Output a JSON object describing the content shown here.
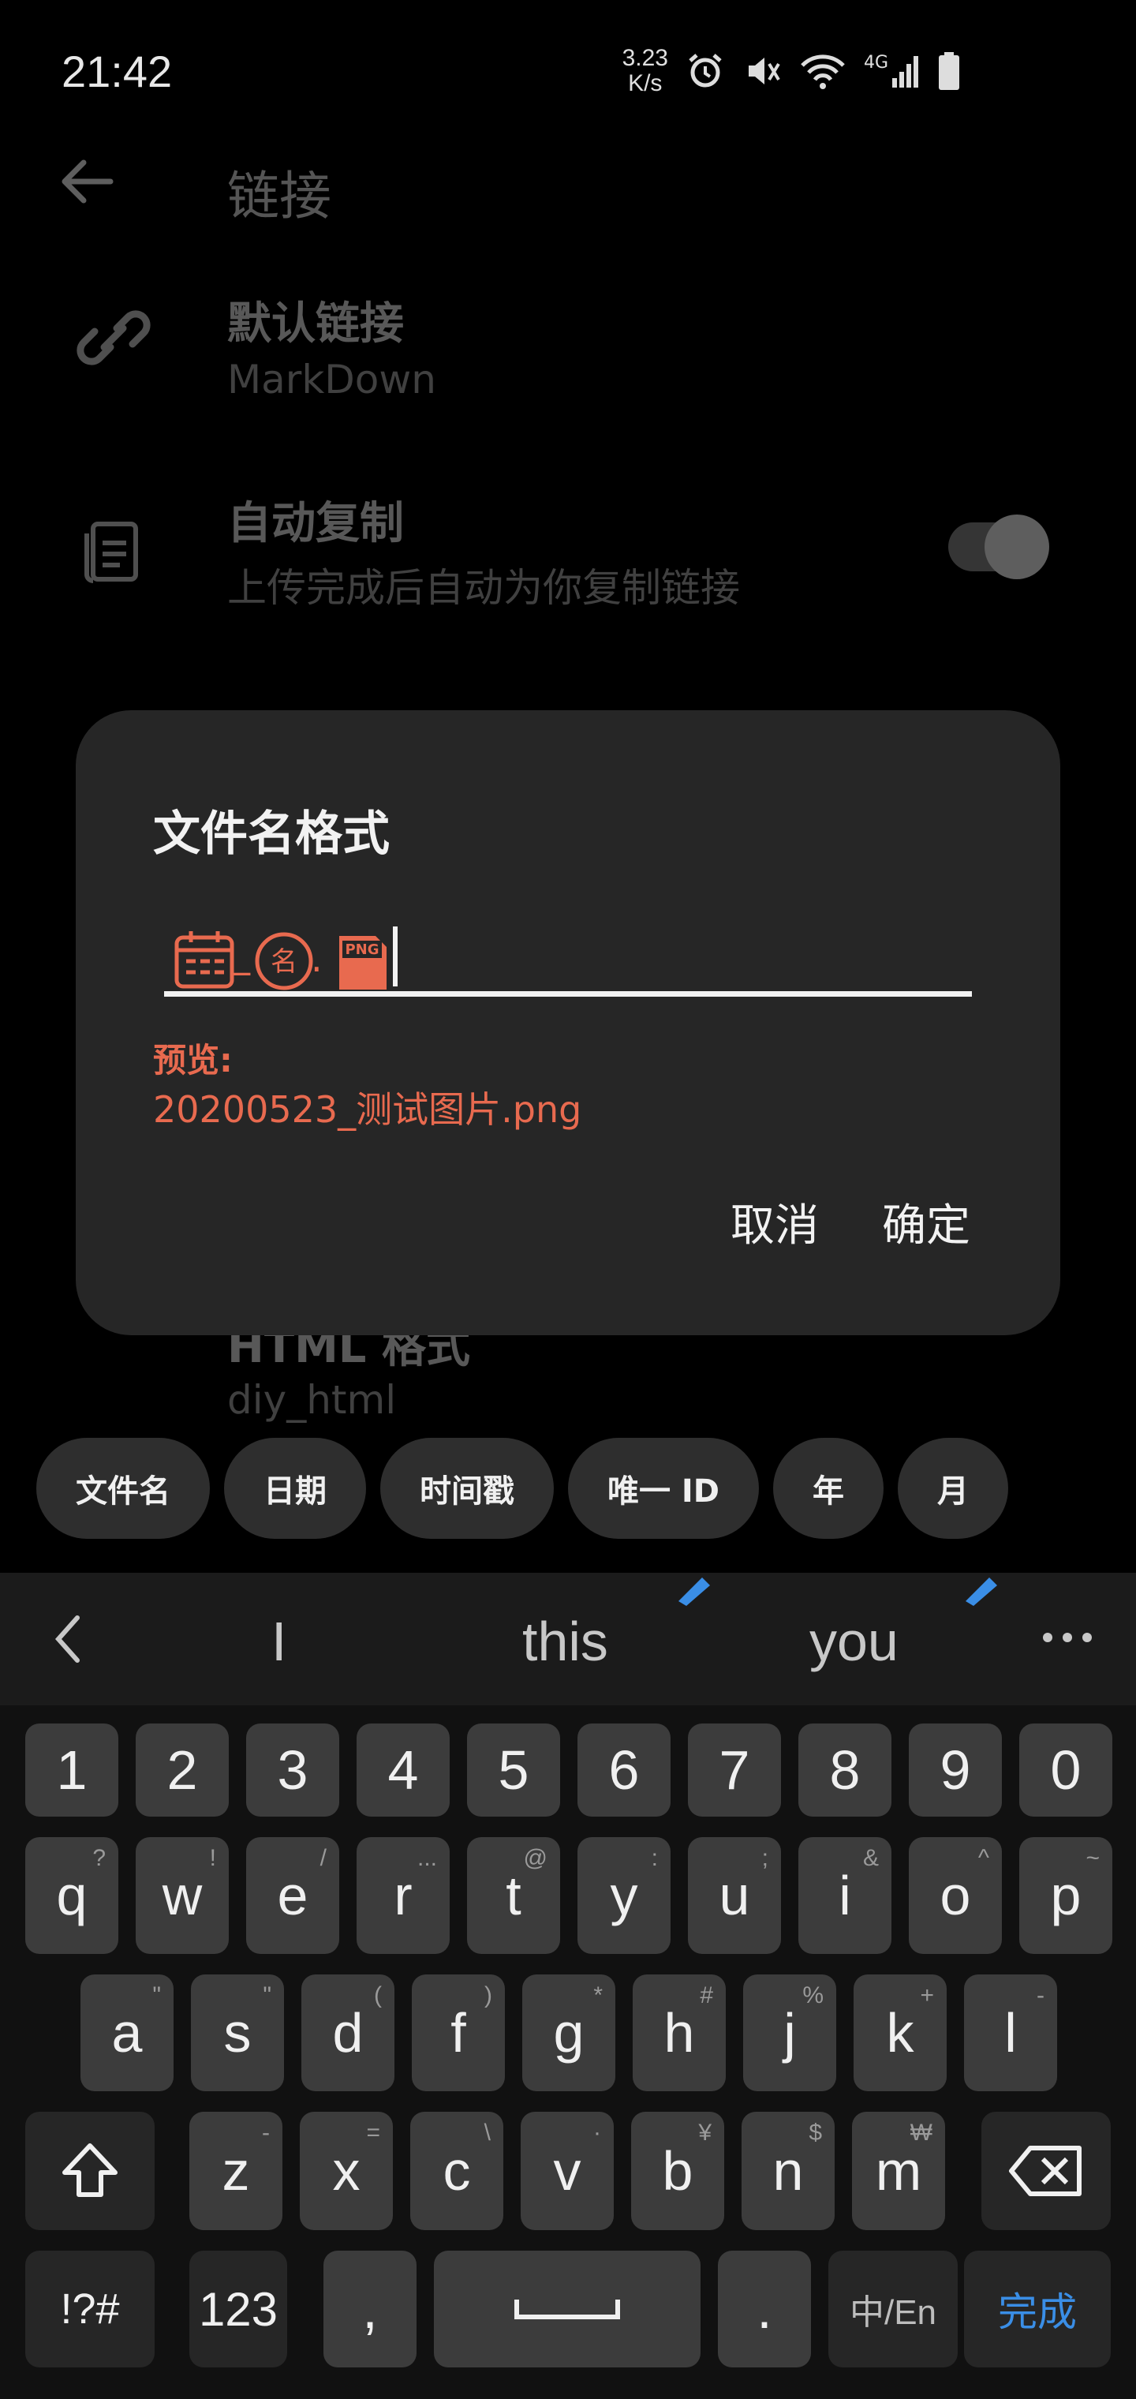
{
  "status": {
    "time": "21:42",
    "net_speed_top": "3.23",
    "net_speed_bottom": "K/s",
    "network": "4G"
  },
  "page": {
    "title": "链接",
    "items": [
      {
        "title": "默认链接",
        "subtitle": "MarkDown"
      },
      {
        "title": "自动复制",
        "subtitle": "上传完成后自动为你复制链接",
        "toggle_on": true
      },
      {
        "title": "HTML 格式",
        "subtitle": "diy_html"
      }
    ]
  },
  "dialog": {
    "title": "文件名格式",
    "preview_label": "预览:",
    "preview_value": "20200523_测试图片.png",
    "cancel": "取消",
    "confirm": "确定",
    "tokens": [
      {
        "icon": "calendar-icon",
        "separator": "_"
      },
      {
        "icon": "name-icon",
        "glyph": "名",
        "separator": "."
      },
      {
        "icon": "png-icon",
        "glyph": "PNG"
      }
    ]
  },
  "chips": [
    "文件名",
    "日期",
    "时间戳",
    "唯一 ID",
    "年",
    "月"
  ],
  "keyboard": {
    "suggestions": [
      "I",
      "this",
      "you"
    ],
    "row_numbers": [
      "1",
      "2",
      "3",
      "4",
      "5",
      "6",
      "7",
      "8",
      "9",
      "0"
    ],
    "row1": [
      [
        "q",
        "?"
      ],
      [
        "w",
        "!"
      ],
      [
        "e",
        "/"
      ],
      [
        "r",
        "..."
      ],
      [
        "t",
        "@"
      ],
      [
        "y",
        ":"
      ],
      [
        "u",
        ";"
      ],
      [
        "i",
        "&"
      ],
      [
        "o",
        "^"
      ],
      [
        "p",
        "~"
      ]
    ],
    "row2": [
      [
        "a",
        "\""
      ],
      [
        "s",
        "\""
      ],
      [
        "d",
        "("
      ],
      [
        "f",
        ")"
      ],
      [
        "g",
        "*"
      ],
      [
        "h",
        "#"
      ],
      [
        "j",
        "%"
      ],
      [
        "k",
        "+"
      ],
      [
        "l",
        "-"
      ]
    ],
    "row3": [
      [
        "z",
        "-"
      ],
      [
        "x",
        "="
      ],
      [
        "c",
        "\\"
      ],
      [
        "v",
        "·"
      ],
      [
        "b",
        "¥"
      ],
      [
        "n",
        "$"
      ],
      [
        "m",
        "₩"
      ]
    ],
    "symbols_key": "!?#",
    "num_key": "123",
    "comma_key": ",",
    "period_key": ".",
    "lang_key": "中/En",
    "done_key": "完成",
    "accent": "#3a8ee6"
  },
  "colors": {
    "accent": "#e86a4f"
  }
}
